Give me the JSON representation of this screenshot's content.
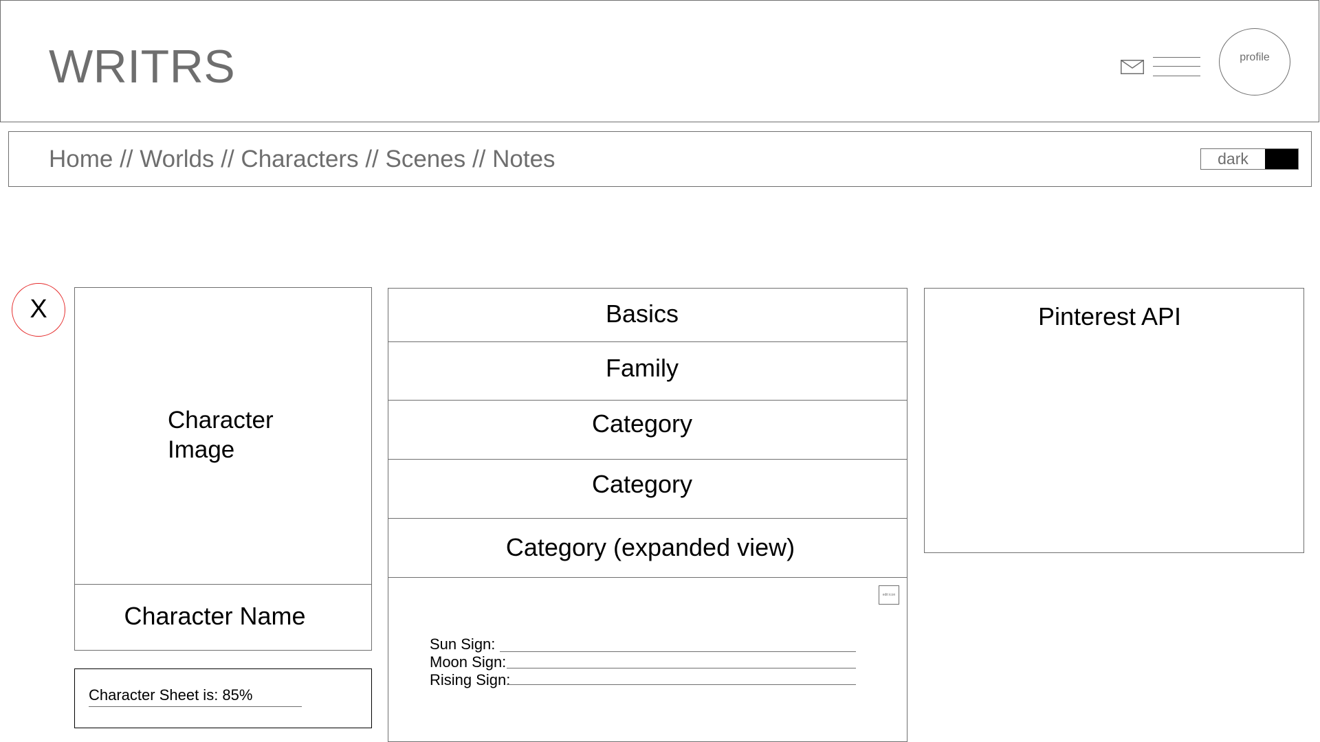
{
  "header": {
    "logo": "WRITRS",
    "mail_icon": "mail-icon",
    "menu_icon": "hamburger-menu-icon",
    "profile_label": "profile"
  },
  "nav": {
    "breadcrumb": "Home // Worlds // Characters // Scenes // Notes",
    "theme_toggle_label": "dark"
  },
  "close_button": {
    "label": "X"
  },
  "character": {
    "image_label": "Character Image",
    "name_label": "Character Name",
    "sheet_status": "Character Sheet is: 85%"
  },
  "sections": [
    {
      "label": "Basics"
    },
    {
      "label": "Family"
    },
    {
      "label": "Category"
    },
    {
      "label": "Category"
    },
    {
      "label": "Category (expanded view)"
    }
  ],
  "expanded": {
    "edit_icon_label": "edit icon",
    "fields": [
      {
        "label": "Sun Sign:"
      },
      {
        "label": "Moon Sign:"
      },
      {
        "label": "Rising Sign:"
      }
    ]
  },
  "pinterest": {
    "title": "Pinterest API"
  },
  "colors": {
    "outline": "#6e6e6e",
    "close_accent": "#e52a2a",
    "toggle_swatch": "#000000"
  }
}
